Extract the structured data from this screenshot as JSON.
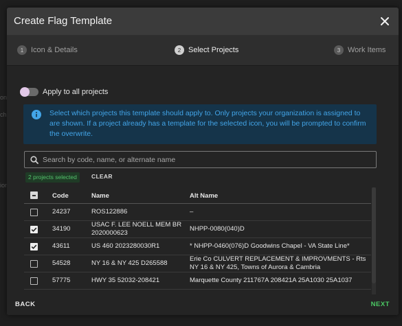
{
  "background": {
    "fragments": [
      "on",
      "ch",
      "ion"
    ]
  },
  "modal": {
    "title": "Create Flag Template",
    "close_icon": "close-icon"
  },
  "stepper": {
    "steps": [
      {
        "number": "1",
        "label": "Icon & Details",
        "active": false
      },
      {
        "number": "2",
        "label": "Select Projects",
        "active": true
      },
      {
        "number": "3",
        "label": "Work Items",
        "active": false
      }
    ]
  },
  "toggle": {
    "label": "Apply to all projects",
    "on": false
  },
  "info": {
    "icon": "info-icon",
    "text": "Select which projects this template should apply to. Only projects your organization is assigned to are shown. If a project already has a template for the selected icon, you will be prompted to confirm the overwrite."
  },
  "search": {
    "placeholder": "Search by code, name, or alternate name",
    "value": ""
  },
  "selection": {
    "badge": "2 projects selected",
    "clear_label": "CLEAR"
  },
  "table": {
    "headers": {
      "code": "Code",
      "name": "Name",
      "alt": "Alt Name"
    },
    "rows": [
      {
        "checked": false,
        "code": "24237",
        "name": "ROS122886",
        "alt": "–"
      },
      {
        "checked": true,
        "code": "34190",
        "name": "USAC F. LEE NOELL MEM BR 2020000623",
        "alt": "NHPP-0080(040)D"
      },
      {
        "checked": true,
        "code": "43611",
        "name": "US 460 2023280030R1",
        "alt": "* NHPP-0460(076)D Goodwins Chapel - VA State Line*"
      },
      {
        "checked": false,
        "code": "54528",
        "name": "NY 16 & NY 425 D265588",
        "alt": "Erie Co CULVERT REPLACEMENT & IMPROVMENTS - Rts NY 16 & NY 425, Towns of Aurora & Cambria"
      },
      {
        "checked": false,
        "code": "57775",
        "name": "HWY 35 52032-208421",
        "alt": "Marquette County 211767A 208421A 25A1030 25A1037"
      }
    ]
  },
  "footer": {
    "back_label": "BACK",
    "next_label": "NEXT"
  },
  "colors": {
    "accent_green": "#4bc863",
    "info_bg": "#15344a",
    "info_text": "#43a5e8",
    "header_bg": "#3b3b3b"
  }
}
